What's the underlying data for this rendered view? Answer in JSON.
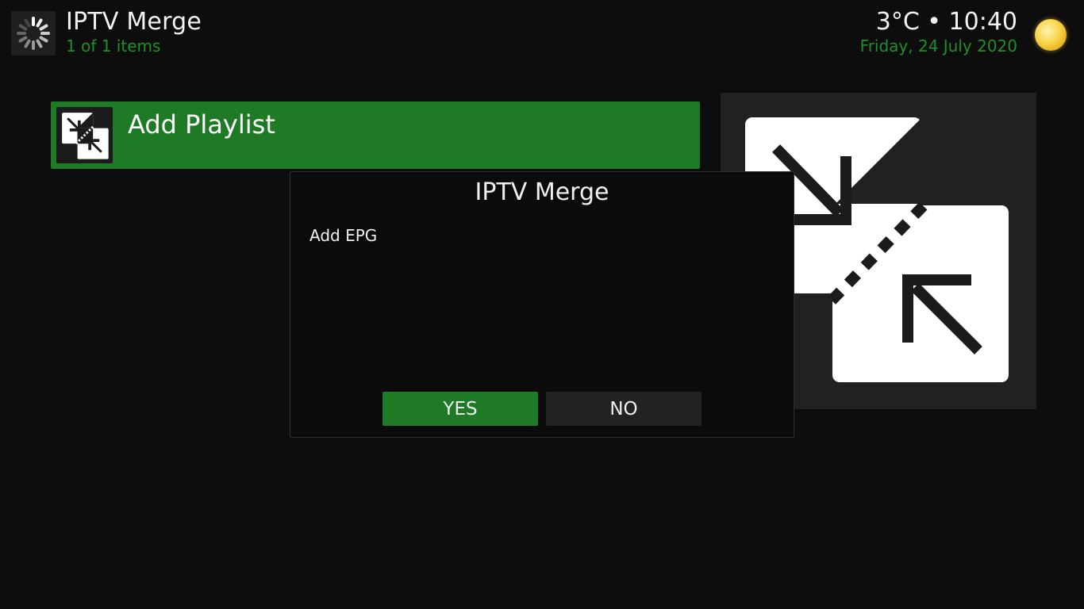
{
  "header": {
    "title": "IPTV Merge",
    "subtitle": "1 of 1 items",
    "time": "3°C • 10:40",
    "date": "Friday, 24 July 2020",
    "loading_icon": "spinner-icon",
    "weather_icon": "sun-icon"
  },
  "list": {
    "items": [
      {
        "label": "Add Playlist",
        "icon": "merge-arrows-icon"
      }
    ]
  },
  "preview": {
    "icon": "merge-arrows-icon"
  },
  "dialog": {
    "title": "IPTV Merge",
    "message": "Add EPG",
    "yes_label": "YES",
    "no_label": "NO"
  },
  "colors": {
    "accent": "#1e7a25",
    "accent_text": "#1f8f2a",
    "background": "#0d0d0d",
    "panel": "#212121"
  }
}
